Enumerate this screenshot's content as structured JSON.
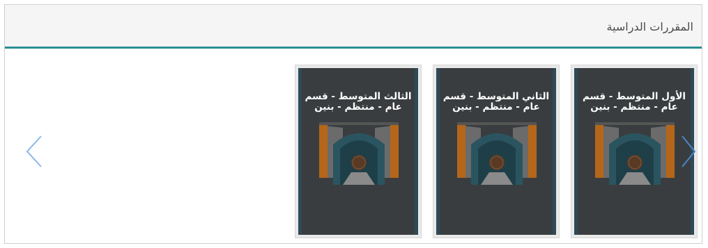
{
  "panel": {
    "title": "المقررات الدراسية"
  },
  "courses": [
    {
      "title": "الأول المتوسط - قسم عام - منتظم - بنين"
    },
    {
      "title": "الثاني المتوسط - قسم عام - منتظم - بنين"
    },
    {
      "title": "الثالث المتوسط - قسم عام - منتظم - بنين"
    }
  ],
  "icons": {
    "prev": "chevron-left-icon",
    "next": "chevron-right-icon"
  },
  "colors": {
    "accent": "#2b8f92",
    "card_bg": "#3a3d3f",
    "arch_teal": "#2a5560",
    "arch_orange": "#b5661a",
    "arrow_blue": "#8ab8e8"
  }
}
